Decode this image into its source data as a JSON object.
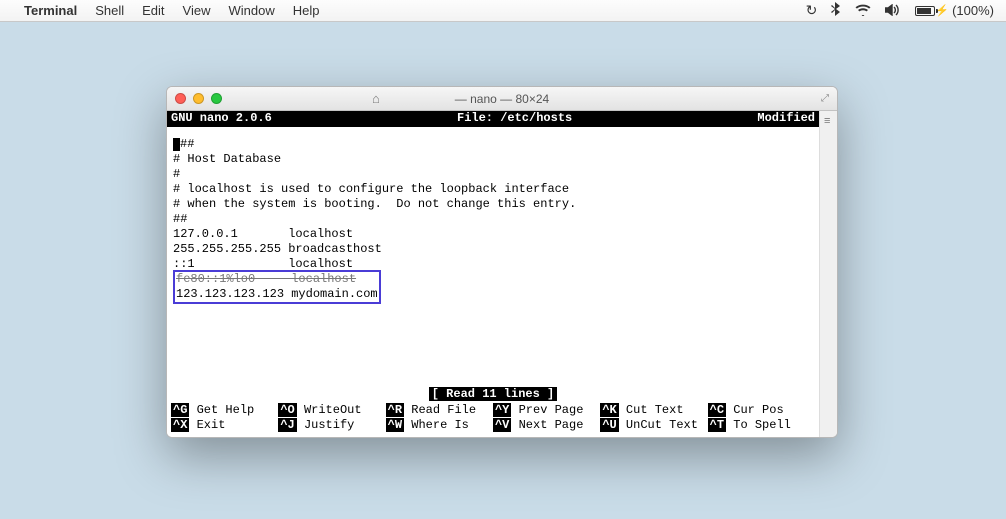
{
  "menubar": {
    "app": "Terminal",
    "items": [
      "Shell",
      "Edit",
      "View",
      "Window",
      "Help"
    ],
    "battery_pct": "(100%)"
  },
  "window": {
    "title": "— nano — 80×24"
  },
  "nano": {
    "version": "GNU nano 2.0.6",
    "file_label": "File: /etc/hosts",
    "modified": "Modified",
    "lines": [
      "##",
      "# Host Database",
      "#",
      "# localhost is used to configure the loopback interface",
      "# when the system is booting.  Do not change this entry.",
      "##",
      "127.0.0.1       localhost",
      "255.255.255.255 broadcasthost",
      "::1             localhost",
      "fe80::1%lo0     localhost",
      "123.123.123.123 mydomain.com"
    ],
    "status": "[ Read 11 lines ]",
    "shortcuts": {
      "row1": [
        {
          "k": "^G",
          "t": "Get Help"
        },
        {
          "k": "^O",
          "t": "WriteOut"
        },
        {
          "k": "^R",
          "t": "Read File"
        },
        {
          "k": "^Y",
          "t": "Prev Page"
        },
        {
          "k": "^K",
          "t": "Cut Text"
        },
        {
          "k": "^C",
          "t": "Cur Pos"
        }
      ],
      "row2": [
        {
          "k": "^X",
          "t": "Exit"
        },
        {
          "k": "^J",
          "t": "Justify"
        },
        {
          "k": "^W",
          "t": "Where Is"
        },
        {
          "k": "^V",
          "t": "Next Page"
        },
        {
          "k": "^U",
          "t": "UnCut Text"
        },
        {
          "k": "^T",
          "t": "To Spell"
        }
      ]
    }
  }
}
